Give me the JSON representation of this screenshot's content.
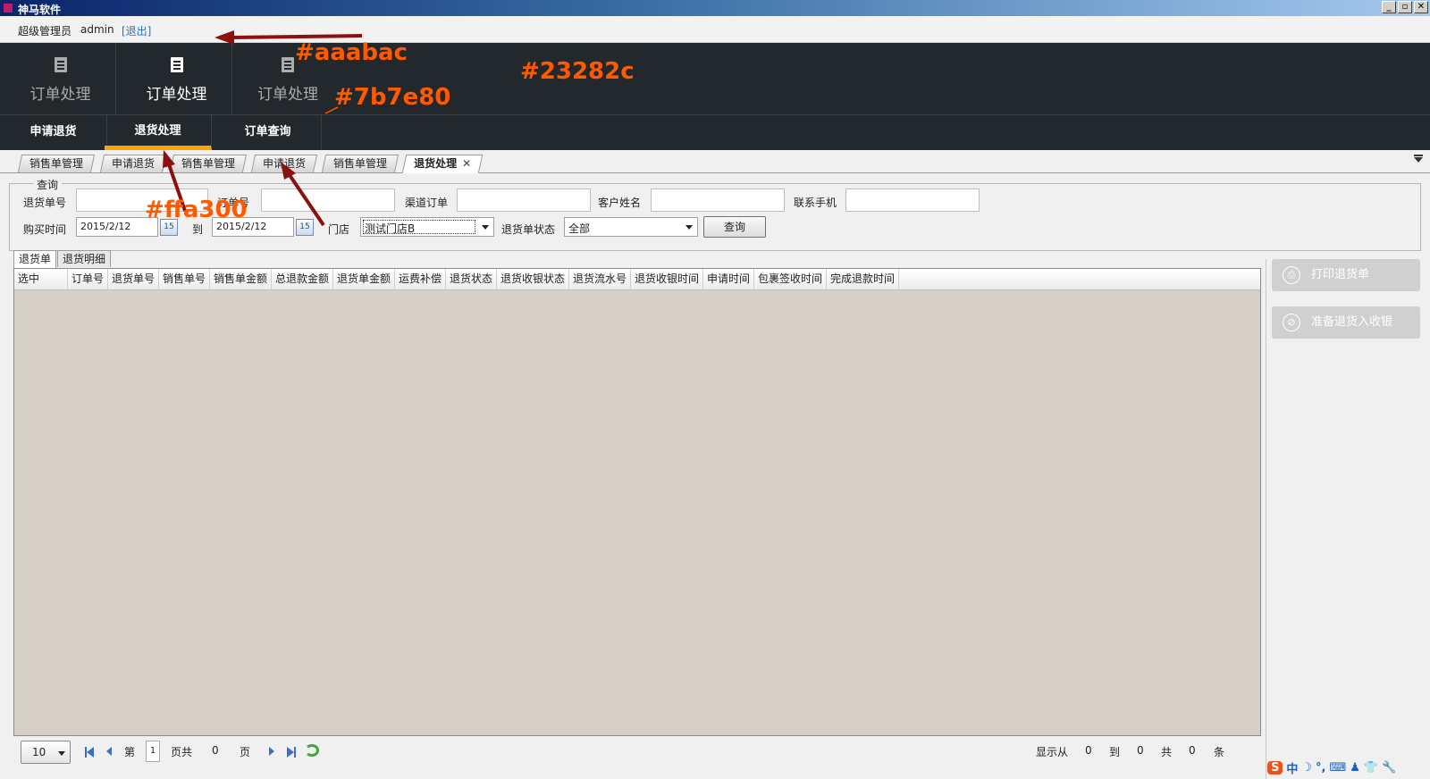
{
  "window": {
    "title": "神马软件",
    "buttons": [
      "_",
      "▫",
      "✕"
    ]
  },
  "userbar": {
    "role": "超级管理员",
    "username": "admin",
    "logout": "[退出]"
  },
  "main_nav": {
    "items": [
      {
        "label": "订单处理",
        "icon": "document-icon",
        "active": false
      },
      {
        "label": "订单处理",
        "icon": "document-icon",
        "active": true
      },
      {
        "label": "订单处理",
        "icon": "document-icon",
        "active": false
      }
    ],
    "bg_color": "#23282c",
    "text_color": "#aaabac",
    "divider_color": "#7b7e80"
  },
  "sub_nav": {
    "items": [
      {
        "label": "申请退货",
        "active": false
      },
      {
        "label": "退货处理",
        "active": true
      },
      {
        "label": "订单查询",
        "active": false
      }
    ],
    "accent_color": "#ffa300"
  },
  "doc_tabs": [
    {
      "label": "销售单管理"
    },
    {
      "label": "申请退货"
    },
    {
      "label": "销售单管理"
    },
    {
      "label": "申请退货"
    },
    {
      "label": "销售单管理"
    },
    {
      "label": "退货处理",
      "active": true,
      "close": "✕"
    }
  ],
  "query": {
    "legend": "查询",
    "fields": {
      "return_no": {
        "label": "退货单号",
        "value": ""
      },
      "order_no": {
        "label": "订单号",
        "value": ""
      },
      "channel_order": {
        "label": "渠道订单",
        "value": ""
      },
      "customer_name": {
        "label": "客户姓名",
        "value": ""
      },
      "phone": {
        "label": "联系手机",
        "value": ""
      }
    },
    "purchase_time": {
      "label": "购买时间",
      "from": "2015/2/12",
      "to_label": "到",
      "to": "2015/2/12",
      "cal": "15"
    },
    "store": {
      "label": "门店",
      "value": "测试门店B"
    },
    "status": {
      "label": "退货单状态",
      "value": "全部"
    },
    "search_button": "查询"
  },
  "grid_tabs": [
    {
      "label": "退货单",
      "active": true
    },
    {
      "label": "退货明细",
      "active": false
    }
  ],
  "grid": {
    "columns": [
      "选中",
      "订单号",
      "退货单号",
      "销售单号",
      "销售单金额",
      "总退款金额",
      "退货单金额",
      "运费补偿",
      "退货状态",
      "退货收银状态",
      "退货流水号",
      "退货收银时间",
      "申请时间",
      "包裹签收时间",
      "完成退款时间"
    ],
    "rows": []
  },
  "pager": {
    "page_size": "10",
    "page_prefix": "第",
    "page": "1",
    "page_mid": "页共",
    "total_pages": "0",
    "page_suffix": "页",
    "show_from": "显示从",
    "from": "0",
    "to_label": "到",
    "to": "0",
    "total_label": "共",
    "total": "0",
    "unit": "条"
  },
  "side_actions": [
    {
      "label": "打印退货单",
      "icon": "printer-icon"
    },
    {
      "label": "准备退货入收银",
      "icon": "edit-icon"
    }
  ],
  "ime": {
    "brand": "S",
    "items": [
      "中",
      "☽",
      "°,",
      "⌨",
      "♟",
      "👕",
      "🔧"
    ]
  },
  "annotations": [
    "#aaabac",
    "#7b7e80",
    "#23282c",
    "#ffa300"
  ]
}
